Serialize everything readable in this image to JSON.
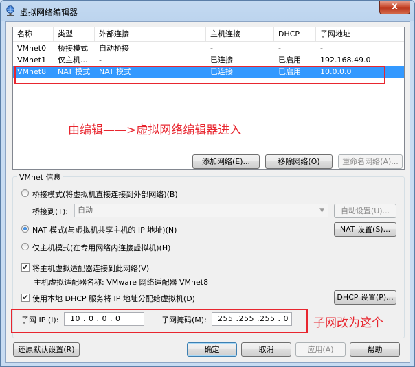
{
  "window": {
    "title": "虚拟网络编辑器",
    "close_glyph": "x"
  },
  "list": {
    "columns": [
      "名称",
      "类型",
      "外部连接",
      "主机连接",
      "DHCP",
      "子网地址"
    ],
    "rows": [
      [
        "VMnet0",
        "桥接模式",
        "自动桥接",
        "-",
        "-",
        "-"
      ],
      [
        "VMnet1",
        "仅主机...",
        "-",
        "已连接",
        "已启用",
        "192.168.49.0"
      ],
      [
        "VMnet8",
        "NAT 模式",
        "NAT 模式",
        "已连接",
        "已启用",
        "10.0.0.0"
      ]
    ],
    "selected_index": 2
  },
  "annotations": {
    "edit_note": "由编辑——>虚拟网络编辑器进入",
    "subnet_note": "子网改为这个",
    "color": "#e8262f"
  },
  "list_buttons": {
    "add": "添加网络(E)...",
    "remove": "移除网络(O)",
    "rename": "重命名网络(A)..."
  },
  "vmnet_info": {
    "title": "VMnet 信息",
    "bridge_mode": "桥接模式(将虚拟机直接连接到外部网络)(B)",
    "bridge_to_label": "桥接到(T):",
    "bridge_to_value": "自动",
    "auto_settings": "自动设置(U)...",
    "nat_mode": "NAT 模式(与虚拟机共享主机的 IP 地址)(N)",
    "nat_settings": "NAT 设置(S)...",
    "host_only": "仅主机模式(在专用网络内连接虚拟机)(H)",
    "connect_adapter": "将主机虚拟适配器连接到此网络(V)",
    "adapter_name": "主机虚拟适配器名称: VMware 网络适配器 VMnet8",
    "use_dhcp": "使用本地 DHCP 服务将 IP 地址分配给虚拟机(D)",
    "dhcp_settings": "DHCP 设置(P)...",
    "check_glyph": "✔",
    "selected_mode": "nat",
    "connect_adapter_checked": true,
    "use_dhcp_checked": true
  },
  "subnet": {
    "ip_label": "子网 IP (I):",
    "ip_value": "10 . 0 . 0 . 0",
    "mask_label": "子网掩码(M):",
    "mask_value": "255 .255 .255 . 0"
  },
  "footer": {
    "restore": "还原默认设置(R)",
    "ok": "确定",
    "cancel": "取消",
    "apply": "应用(A)",
    "help": "帮助"
  },
  "colors": {
    "selection": "#3399ff",
    "title_bar": "#c4daf1"
  }
}
